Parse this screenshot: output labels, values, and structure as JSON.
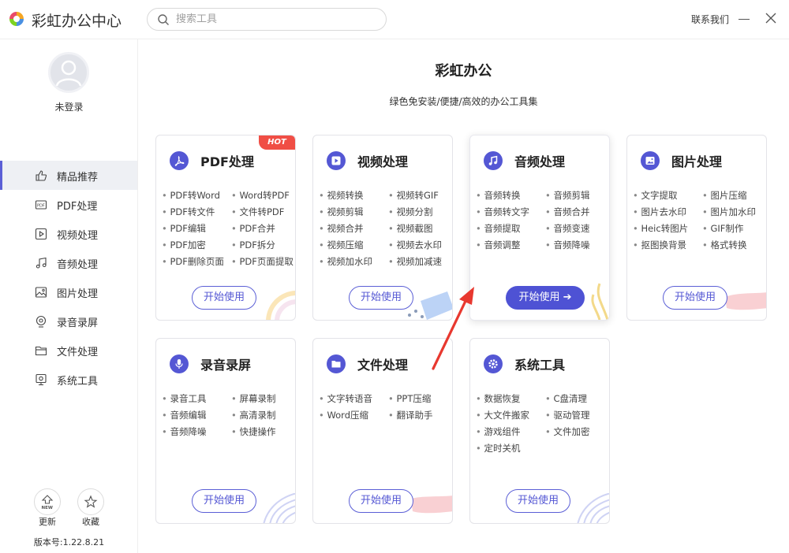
{
  "app": {
    "title": "彩虹办公中心"
  },
  "search": {
    "placeholder": "搜索工具"
  },
  "header": {
    "contact": "联系我们"
  },
  "user": {
    "login_status": "未登录"
  },
  "sidebar": {
    "items": [
      {
        "label": "精品推荐",
        "icon": "thumbs-up-icon",
        "active": true
      },
      {
        "label": "PDF处理",
        "icon": "pdf-icon"
      },
      {
        "label": "视频处理",
        "icon": "video-icon"
      },
      {
        "label": "音频处理",
        "icon": "music-icon"
      },
      {
        "label": "图片处理",
        "icon": "image-icon"
      },
      {
        "label": "录音录屏",
        "icon": "record-icon"
      },
      {
        "label": "文件处理",
        "icon": "folder-icon"
      },
      {
        "label": "系统工具",
        "icon": "monitor-icon"
      }
    ],
    "update_label": "更新",
    "update_badge": "NEW",
    "favorite_label": "收藏",
    "version": "版本号:1.22.8.21"
  },
  "main": {
    "title": "彩虹办公",
    "subtitle": "绿色免安装/便捷/高效的办公工具集",
    "start_label": "开始使用",
    "start_label_primary": "开始使用 ➔",
    "hot_badge": "HOT",
    "cards": [
      {
        "title": "PDF处理",
        "icon": "pdf-acrobat-icon",
        "tools": [
          "PDF转Word",
          "Word转PDF",
          "PDF转文件",
          "文件转PDF",
          "PDF编辑",
          "PDF合并",
          "PDF加密",
          "PDF拆分",
          "PDF删除页面",
          "PDF页面提取"
        ]
      },
      {
        "title": "视频处理",
        "icon": "play-icon",
        "tools": [
          "视频转换",
          "视频转GIF",
          "视频剪辑",
          "视频分割",
          "视频合并",
          "视频截图",
          "视频压缩",
          "视频去水印",
          "视频加水印",
          "视频加减速"
        ]
      },
      {
        "title": "音频处理",
        "icon": "music-note-icon",
        "tools": [
          "音频转换",
          "音频剪辑",
          "音频转文字",
          "音频合并",
          "音频提取",
          "音频变速",
          "音频调整",
          "音频降噪"
        ]
      },
      {
        "title": "图片处理",
        "icon": "picture-icon",
        "tools": [
          "文字提取",
          "图片压缩",
          "图片去水印",
          "图片加水印",
          "Heic转图片",
          "GIF制作",
          "抠图换背景",
          "格式转换"
        ]
      },
      {
        "title": "录音录屏",
        "icon": "microphone-icon",
        "tools": [
          "录音工具",
          "屏幕录制",
          "音频编辑",
          "高清录制",
          "音频降噪",
          "快捷操作"
        ]
      },
      {
        "title": "文件处理",
        "icon": "folder-open-icon",
        "tools": [
          "文字转语音",
          "PPT压缩",
          "Word压缩",
          "翻译助手"
        ]
      },
      {
        "title": "系统工具",
        "icon": "gear-icon",
        "tools": [
          "数据恢复",
          "C盘清理",
          "大文件搬家",
          "驱动管理",
          "游戏组件",
          "文件加密",
          "定时关机"
        ]
      }
    ]
  },
  "colors": {
    "accent": "#5457d4",
    "hot": "#f04e45",
    "annotation": "#e8382f"
  }
}
